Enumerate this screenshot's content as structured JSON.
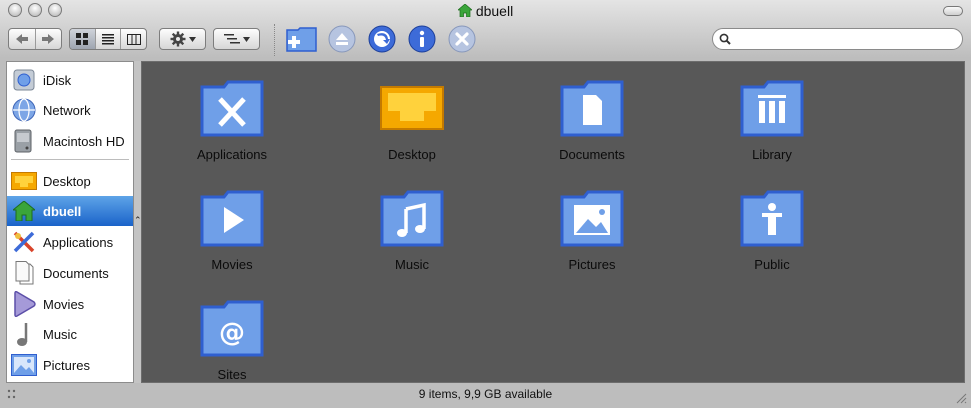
{
  "window": {
    "title": "dbuell"
  },
  "toolbar": {
    "buttons": [
      {
        "name": "back-forward",
        "icon": "back-forward-arrows-icon"
      },
      {
        "name": "view-icon",
        "icon": "icon-view-icon"
      },
      {
        "name": "view-list",
        "icon": "list-view-icon"
      },
      {
        "name": "view-columns",
        "icon": "column-view-icon"
      },
      {
        "name": "action",
        "icon": "gear-icon"
      },
      {
        "name": "arrange",
        "icon": "arrange-icon"
      },
      {
        "name": "new-folder",
        "icon": "new-folder-icon"
      },
      {
        "name": "eject",
        "icon": "eject-icon"
      },
      {
        "name": "burn",
        "icon": "burn-icon"
      },
      {
        "name": "get-info",
        "icon": "info-icon"
      },
      {
        "name": "delete",
        "icon": "delete-icon"
      }
    ],
    "search": {
      "placeholder": "",
      "value": ""
    }
  },
  "sidebar": {
    "devices": [
      {
        "label": "iDisk",
        "icon": "idisk-icon"
      },
      {
        "label": "Network",
        "icon": "network-globe-icon"
      },
      {
        "label": "Macintosh HD",
        "icon": "hard-drive-icon"
      }
    ],
    "places": [
      {
        "label": "Desktop",
        "icon": "desktop-icon"
      },
      {
        "label": "dbuell",
        "icon": "home-icon",
        "selected": true
      },
      {
        "label": "Applications",
        "icon": "applications-icon"
      },
      {
        "label": "Documents",
        "icon": "documents-icon"
      },
      {
        "label": "Movies",
        "icon": "movies-icon"
      },
      {
        "label": "Music",
        "icon": "music-note-icon"
      },
      {
        "label": "Pictures",
        "icon": "pictures-icon"
      }
    ]
  },
  "main": {
    "items": [
      {
        "label": "Applications",
        "icon": "applications-folder-icon"
      },
      {
        "label": "Desktop",
        "icon": "desktop-folder-icon"
      },
      {
        "label": "Documents",
        "icon": "documents-folder-icon"
      },
      {
        "label": "Library",
        "icon": "library-folder-icon"
      },
      {
        "label": "Movies",
        "icon": "movies-folder-icon"
      },
      {
        "label": "Music",
        "icon": "music-folder-icon"
      },
      {
        "label": "Pictures",
        "icon": "pictures-folder-icon"
      },
      {
        "label": "Public",
        "icon": "public-folder-icon"
      },
      {
        "label": "Sites",
        "icon": "sites-folder-icon"
      }
    ]
  },
  "status": {
    "text": "9 items, 9,9 GB available"
  },
  "colors": {
    "folder_blue": "#6f9fe8",
    "folder_border": "#2f5fcf",
    "desktop_orange": "#f5a800",
    "selection_blue": "#1a63c9",
    "main_background": "#585858"
  }
}
